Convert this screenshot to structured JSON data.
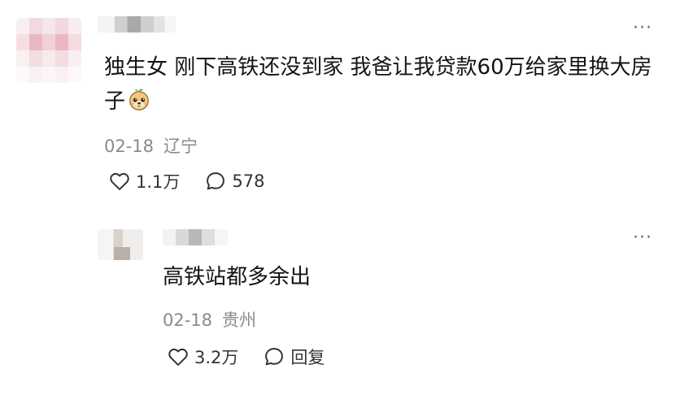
{
  "comments": [
    {
      "avatar": "blurred-avatar",
      "text": "独生女 刚下高铁还没到家 我爸让我贷款60万给家里换大房子",
      "emoji": "dog-face-emoji",
      "date": "02-18",
      "location": "辽宁",
      "like_count": "1.1万",
      "reply_count": "578",
      "more": "···"
    },
    {
      "avatar": "blurred-avatar",
      "text": "高铁站都多余出",
      "date": "02-18",
      "location": "贵州",
      "like_count": "3.2万",
      "reply_label": "回复",
      "more": "···"
    }
  ],
  "icons": {
    "like": "heart-outline-icon",
    "comment": "speech-bubble-icon",
    "more": "more-dots-icon"
  },
  "colors": {
    "text": "#141414",
    "meta": "#8a8a8a",
    "icon": "#333333"
  }
}
